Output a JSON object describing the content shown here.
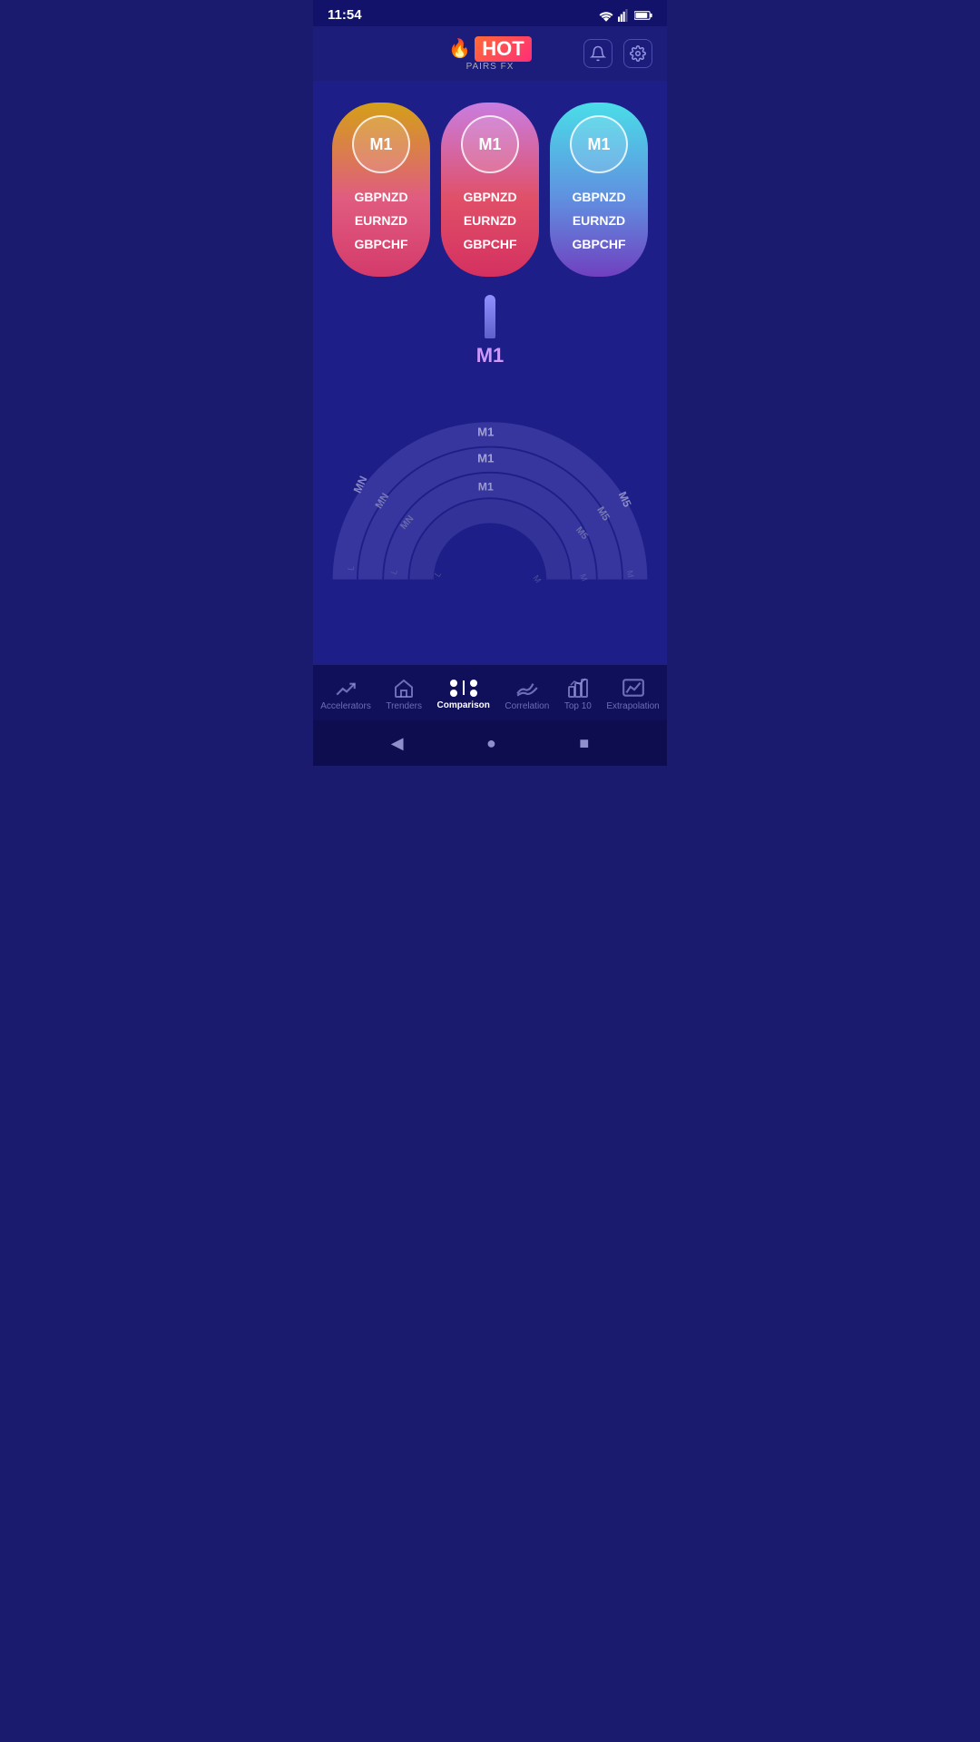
{
  "statusBar": {
    "time": "11:54"
  },
  "header": {
    "logoHot": "HOT",
    "logoPairsFx": "PAIRS FX",
    "flame": "🔥",
    "notificationIcon": "bell",
    "settingsIcon": "gear"
  },
  "cards": [
    {
      "timeframe": "M1",
      "pairs": [
        "GBPNZD",
        "EURNZD",
        "GBPCHF"
      ],
      "gradient": "card-1"
    },
    {
      "timeframe": "M1",
      "pairs": [
        "GBPNZD",
        "EURNZD",
        "GBPCHF"
      ],
      "gradient": "card-2"
    },
    {
      "timeframe": "M1",
      "pairs": [
        "GBPNZD",
        "EURNZD",
        "GBPCHF"
      ],
      "gradient": "card-3"
    }
  ],
  "gauge": {
    "centerLabel": "M1",
    "arcLabels": {
      "left1": "MN",
      "left2": "MN",
      "left3": "MN",
      "right1": "M5",
      "right2": "M5",
      "right3": "M5",
      "center1": "M1",
      "center2": "M1",
      "center3": "M1"
    }
  },
  "bottomNav": {
    "items": [
      {
        "id": "accelerators",
        "label": "Accelerators",
        "icon": "trend-up",
        "active": false
      },
      {
        "id": "trenders",
        "label": "Trenders",
        "icon": "home",
        "active": false
      },
      {
        "id": "comparison",
        "label": "Comparison",
        "icon": "comparison",
        "active": true
      },
      {
        "id": "correlation",
        "label": "Correlation",
        "icon": "correlation",
        "active": false
      },
      {
        "id": "top10",
        "label": "Top 10",
        "icon": "top10",
        "active": false
      },
      {
        "id": "extrapolation",
        "label": "Extrapolation",
        "icon": "extrapolation",
        "active": false
      }
    ]
  },
  "systemNav": {
    "back": "◀",
    "home": "●",
    "recent": "■"
  }
}
